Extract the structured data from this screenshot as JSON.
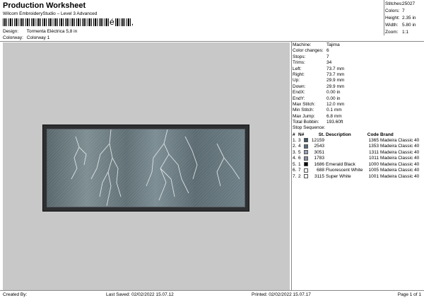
{
  "header": {
    "title": "Production Worksheet",
    "subtitle": "Wilcom EmbroideryStudio – Level 3 Advanced",
    "barcode_char": "é",
    "barcode_tail": ","
  },
  "info": [
    {
      "key": "Design:",
      "value": "Tormenta Eléctrica 5,8 in"
    },
    {
      "key": "Colorway:",
      "value": "Colorway 1"
    }
  ],
  "stats": [
    {
      "key": "Stitches:",
      "value": "25027"
    },
    {
      "key": "Colors:",
      "value": "7"
    },
    {
      "key": "Height:",
      "value": "2.35 in"
    },
    {
      "key": "Width:",
      "value": "5.80 in"
    },
    {
      "key": "Zoom:",
      "value": "1:1"
    }
  ],
  "machine_info": [
    {
      "key": "Machine:",
      "value": "Tajima"
    },
    {
      "key": "Color changes:",
      "value": "6"
    },
    {
      "key": "Stops:",
      "value": "7"
    },
    {
      "key": "Trims:",
      "value": "34"
    },
    {
      "key": "Left:",
      "value": "73.7 mm"
    },
    {
      "key": "Right:",
      "value": "73.7 mm"
    },
    {
      "key": "Up:",
      "value": "29.9 mm"
    },
    {
      "key": "Down:",
      "value": "29.9 mm"
    },
    {
      "key": "EndX:",
      "value": "0.00 in"
    },
    {
      "key": "EndY:",
      "value": "0.00 in"
    },
    {
      "key": "Max Stitch:",
      "value": "12.0 mm"
    },
    {
      "key": "Min Stitch:",
      "value": "0.1 mm"
    },
    {
      "key": "Max Jump:",
      "value": "6.8 mm"
    },
    {
      "key": "Total Bobbin:",
      "value": "193.60ft"
    }
  ],
  "stop_sequence": {
    "label": "Stop Sequence:",
    "headers": {
      "num": "#",
      "n": "N#",
      "stitches": "St.",
      "description": "Description",
      "code": "Code",
      "brand": "Brand"
    },
    "rows": [
      {
        "num": "1.",
        "n": "3",
        "color": "#3f5766",
        "stitches": "12159",
        "description": "",
        "code": "1365",
        "brand": "Madeira Classic 40"
      },
      {
        "num": "2.",
        "n": "4",
        "color": "#5a6e7c",
        "stitches": "2543",
        "description": "",
        "code": "1353",
        "brand": "Madeira Classic 40"
      },
      {
        "num": "3.",
        "n": "5",
        "color": "#9a9fba",
        "stitches": "3051",
        "description": "",
        "code": "1311",
        "brand": "Madeira Classic 40"
      },
      {
        "num": "4.",
        "n": "6",
        "color": "#8a8fa4",
        "stitches": "1783",
        "description": "",
        "code": "1011",
        "brand": "Madeira Classic 40"
      },
      {
        "num": "5.",
        "n": "1",
        "color": "#000000",
        "stitches": "1686",
        "description": "Emerald Black",
        "code": "1000",
        "brand": "Madeira Classic 40"
      },
      {
        "num": "6.",
        "n": "7",
        "color": "#f3f3f3",
        "stitches": "688",
        "description": "Fluorescent White",
        "code": "1005",
        "brand": "Madeira Classic 40"
      },
      {
        "num": "7.",
        "n": "2",
        "color": "#ffffff",
        "stitches": "3115",
        "description": "Super White",
        "code": "1001",
        "brand": "Madeira Classic 40"
      }
    ]
  },
  "footer": {
    "created_by": "Created By:",
    "last_saved": "Last Saved: 02/02/2022 15.07.12",
    "printed": "Printed: 02/02/2022 15.07.17",
    "page": "Page 1 of 1"
  }
}
